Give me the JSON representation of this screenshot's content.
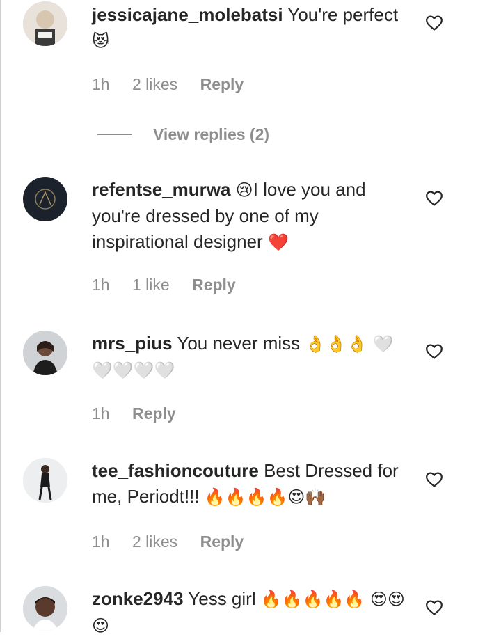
{
  "comments": [
    {
      "username": "jessicajane_molebatsi",
      "text": "You're perfect",
      "emoji": "😻",
      "time": "1h",
      "likes": "2 likes",
      "reply": "Reply",
      "view_replies": "View replies (2)"
    },
    {
      "username": "refentse_murwa",
      "text": "I love you and you're dressed by one of my inspirational designer",
      "emoji_before": "😢",
      "emoji": "❤️",
      "time": "1h",
      "likes": "1 like",
      "reply": "Reply"
    },
    {
      "username": "mrs_pius",
      "text": "You never miss",
      "emoji": "👌👌👌 🤍🤍🤍🤍🤍",
      "time": "1h",
      "reply": "Reply"
    },
    {
      "username": "tee_fashioncouture",
      "text": "Best Dressed for me, Periodt!!!",
      "emoji": "🔥🔥🔥🔥😍🙌🏾",
      "time": "1h",
      "likes": "2 likes",
      "reply": "Reply"
    },
    {
      "username": "zonke2943",
      "text": "Yess girl",
      "emoji": "🔥🔥🔥🔥🔥 😍😍😍"
    }
  ]
}
